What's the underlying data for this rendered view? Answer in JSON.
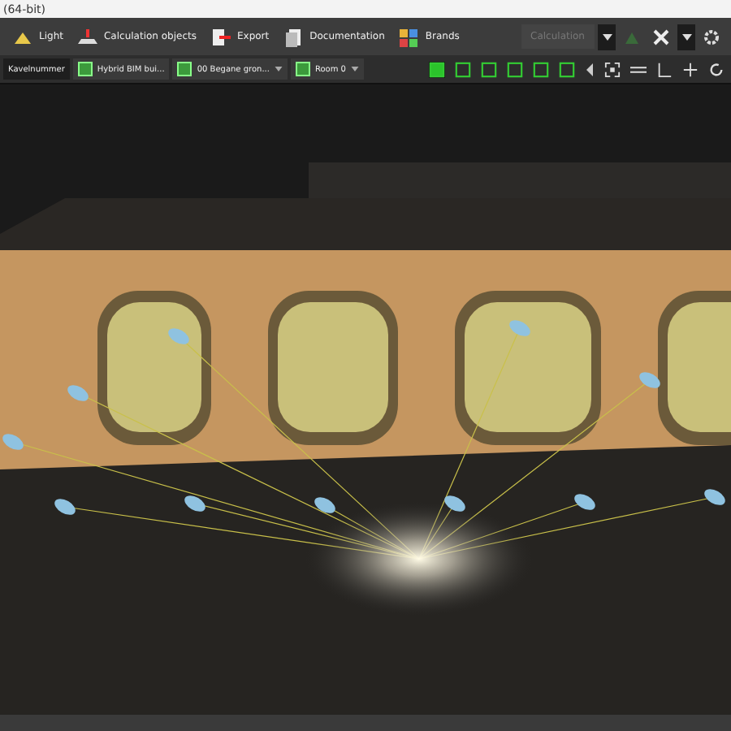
{
  "window": {
    "title": "(64-bit)"
  },
  "menu": [
    {
      "label": "Light",
      "kind": "lamp"
    },
    {
      "label": "Calculation objects",
      "kind": "plane"
    },
    {
      "label": "Export",
      "kind": "export"
    },
    {
      "label": "Documentation",
      "kind": "doc"
    },
    {
      "label": "Brands",
      "kind": "brands"
    }
  ],
  "calculation_button": {
    "label": "Calculation",
    "disabled": true
  },
  "breadcrumbs": [
    {
      "label": "Kavelnummer",
      "selected": true,
      "dropdown": false
    },
    {
      "label": "Hybrid BIM bui...",
      "selected": false,
      "dropdown": false
    },
    {
      "label": "00 Begane gron...",
      "selected": false,
      "dropdown": true
    },
    {
      "label": "Room 0",
      "selected": false,
      "dropdown": true
    }
  ]
}
